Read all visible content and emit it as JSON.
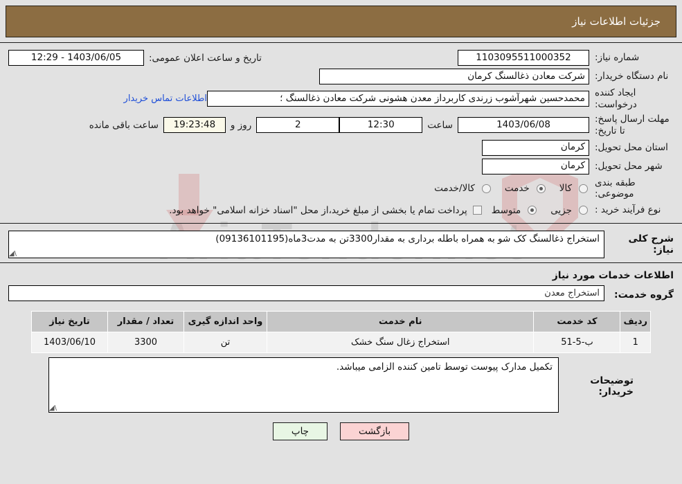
{
  "header": {
    "title": "جزئیات اطلاعات نیاز",
    "bar_color": "#8c6d42"
  },
  "summary": {
    "need_number_label": "شماره نیاز:",
    "need_number_value": "1103095511000352",
    "buyer_org_label": "نام دستگاه خریدار:",
    "buyer_org_value": "شرکت معادن ذغالسنگ کرمان",
    "creator_label": "ایجاد کننده درخواست:",
    "creator_value": "محمدحسین شهرآشوب زرندی کاربرداز معدن هشونی شرکت معادن ذغالسنگ ؛",
    "contact_link": "اطلاعات تماس خریدار",
    "deadline_label": "مهلت ارسال پاسخ: تا تاریخ:",
    "deadline_value": "1403/06/08",
    "province_label": "استان محل تحویل:",
    "province_value": "کرمان",
    "city_label": "شهر محل تحویل:",
    "city_value": "کرمان",
    "public_announce_label": "تاریخ و ساعت اعلان عمومی:",
    "public_announce_value": "1403/06/05 - 12:29",
    "hour_label": "ساعت",
    "hour_value": "12:30",
    "days_value": "2",
    "days_label": "روز و",
    "remaining_value": "19:23:48",
    "remaining_label": "ساعت باقی مانده",
    "classification_label": "طبقه بندی موضوعی:",
    "classification_options": [
      {
        "label": "کالا",
        "selected": false
      },
      {
        "label": "خدمت",
        "selected": true
      },
      {
        "label": "کالا/خدمت",
        "selected": false
      }
    ],
    "process_label": "نوع فرآیند خرید :",
    "process_options": [
      {
        "label": "جزیی",
        "selected": false
      },
      {
        "label": "متوسط",
        "selected": true
      }
    ],
    "treasury_checkbox_label": "پرداخت تمام یا بخشی از مبلغ خرید،از محل \"اسناد خزانه اسلامی\" خواهد بود.",
    "treasury_checked": false
  },
  "description": {
    "label": "شرح کلی نیاز:",
    "value": "استخراج ذغالسنگ کک شو به همراه باطله برداری به مقدار3300تن به مدت3ماه(09136101195)"
  },
  "services": {
    "section_title": "اطلاعات خدمات مورد نیاز",
    "group_label": "گروه خدمت:",
    "group_value": "استخراج معدن",
    "columns": [
      "ردیف",
      "کد خدمت",
      "نام خدمت",
      "واحد اندازه گیری",
      "تعداد / مقدار",
      "تاریخ نیاز"
    ],
    "rows": [
      {
        "radif": "1",
        "code": "ب-5-51",
        "name": "استخراج زغال سنگ خشک",
        "unit": "تن",
        "quantity": "3300",
        "date": "1403/06/10"
      }
    ]
  },
  "notes": {
    "label": "توضیحات خریدار:",
    "value": "تکمیل مدارک پیوست توسط تامین کننده الزامی میباشد."
  },
  "footer": {
    "print_label": "چاپ",
    "back_label": "بازگشت"
  },
  "watermark": {
    "text": "AriaTender.net"
  }
}
